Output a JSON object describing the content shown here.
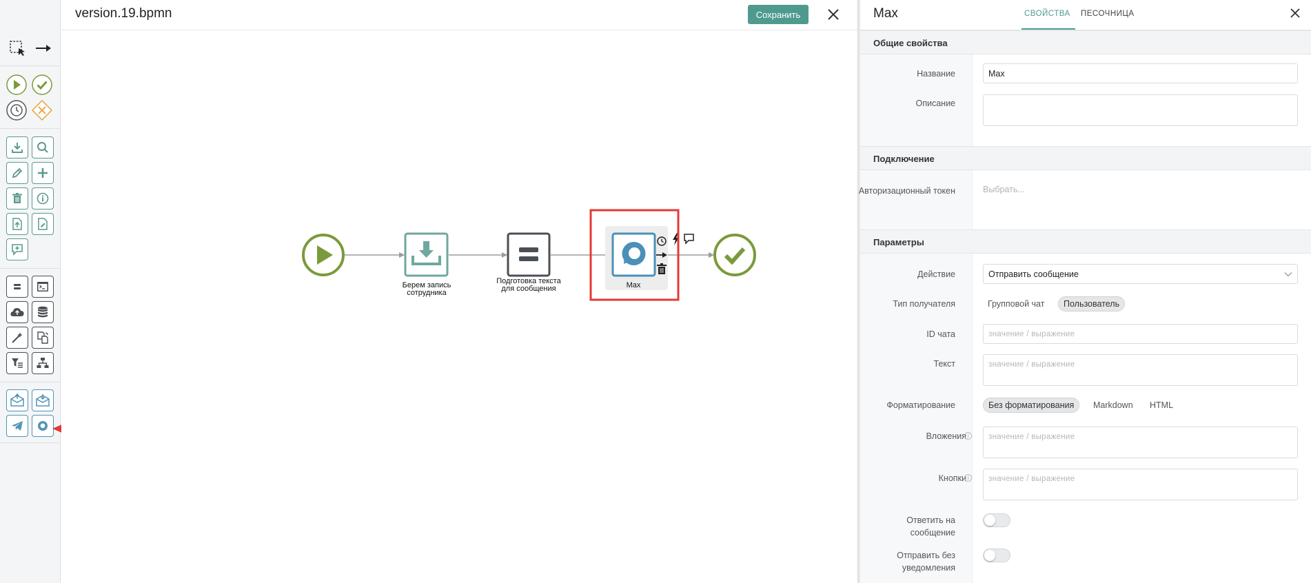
{
  "canvas": {
    "file_title": "version.19.bpmn",
    "save_label": "Сохранить",
    "nodes": {
      "task_1_label": "Берем запись сотрудника",
      "task_2_label": "Подготовка текста для сообщения",
      "task_3_label": "Max"
    }
  },
  "toolbox": {
    "icons": [
      "lasso-icon",
      "connect-arrow-icon",
      "start-event-icon",
      "end-event-icon",
      "timer-event-icon",
      "gateway-icon",
      "download-record-icon",
      "search-icon",
      "edit-icon",
      "add-icon",
      "delete-icon",
      "info-icon",
      "upload-doc-icon",
      "edit-doc-icon",
      "message-icon",
      "variable-icon",
      "script-icon",
      "cloud-icon",
      "database-icon",
      "magic-icon",
      "transform-doc-icon",
      "filter-icon",
      "hierarchy-icon",
      "email-send-icon",
      "email-receive-icon",
      "telegram-icon",
      "max-messenger-icon"
    ]
  },
  "panel": {
    "title": "Max",
    "tabs": [
      "СВОЙСТВА",
      "ПЕСОЧНИЦА"
    ],
    "sections": {
      "general": "Общие свойства",
      "connection": "Подключение",
      "params": "Параметры"
    },
    "fields": {
      "name_label": "Название",
      "name_value": "Max",
      "desc_label": "Описание",
      "token_label": "Авторизационный токен",
      "token_placeholder": "Выбрать...",
      "action_label": "Действие",
      "action_value": "Отправить сообщение",
      "recipient_label": "Тип получателя",
      "recipient_options": [
        "Групповой чат",
        "Пользователь"
      ],
      "chat_id_label": "ID чата",
      "text_label": "Текст",
      "format_label": "Форматирование",
      "format_options": [
        "Без форматирования",
        "Markdown",
        "HTML"
      ],
      "attachments_label": "Вложения",
      "buttons_label": "Кнопки",
      "reply_label": "Ответить на сообщение",
      "silent_label": "Отправить без уведомления",
      "expr_placeholder": "значение  /  выражение"
    }
  },
  "colors": {
    "accent": "#4f9a8f",
    "event_green": "#7a9a3c",
    "highlight_red": "#e53935",
    "max_blue": "#4a90b8"
  }
}
